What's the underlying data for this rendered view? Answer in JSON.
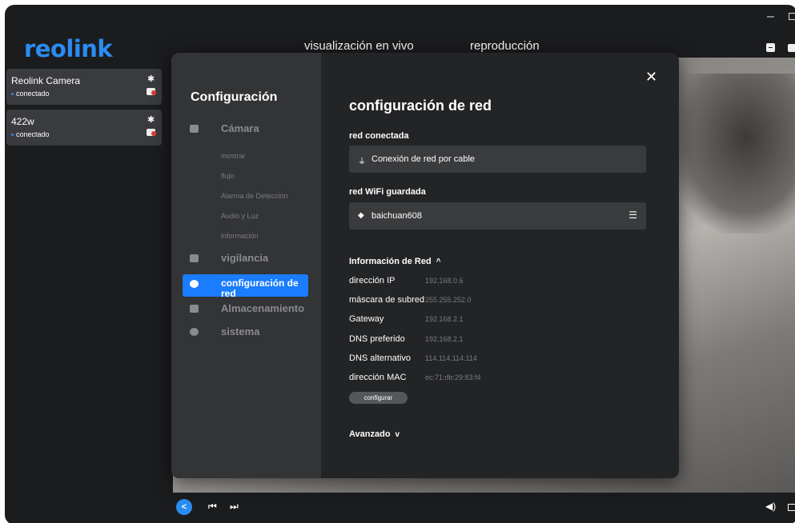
{
  "app": {
    "logo": "reolink",
    "tabs": {
      "live": "visualización en vivo",
      "playback": "reproducción"
    }
  },
  "sidebar": {
    "cameras": [
      {
        "name": "Reolink Camera",
        "status": "conectado"
      },
      {
        "name": "422w",
        "status": "conectado"
      }
    ]
  },
  "settings_menu": {
    "title": "Configuración",
    "items": {
      "camera": "Cámara",
      "surveillance": "vigilancia",
      "network": "configuración de red",
      "storage": "Almacenamiento",
      "system": "sistema"
    },
    "camera_sub": [
      "mostrar",
      "flujo",
      "Alarma de Detección",
      "Audio y Luz",
      "información"
    ]
  },
  "content": {
    "title": "configuración de red",
    "connected_label": "red conectada",
    "connected_value": "Conexión de red por cable",
    "wifi_label": "red WiFi guardada",
    "wifi_value": "baichuan608",
    "info_header": "Información de Red",
    "info_rows": [
      {
        "key": "dirección IP",
        "value": "192.168.0.6"
      },
      {
        "key": "máscara de subred",
        "value": "255.255.252.0"
      },
      {
        "key": "Gateway",
        "value": "192.168.2.1"
      },
      {
        "key": "DNS preferido",
        "value": "192.168.2.1"
      },
      {
        "key": "DNS alternativo",
        "value": "114.114.114.114"
      },
      {
        "key": "dirección MAC",
        "value": "ec:71:db:29:83:f4"
      }
    ],
    "configure_button": "configurar",
    "advanced_header": "Avanzado"
  },
  "icons": {
    "close": "close-icon",
    "ethernet": "ethernet-icon",
    "wifi": "wifi-icon",
    "settings_sliders": "sliders-icon"
  },
  "colors": {
    "accent": "#1a7cff",
    "logo": "#2b8cf2"
  }
}
